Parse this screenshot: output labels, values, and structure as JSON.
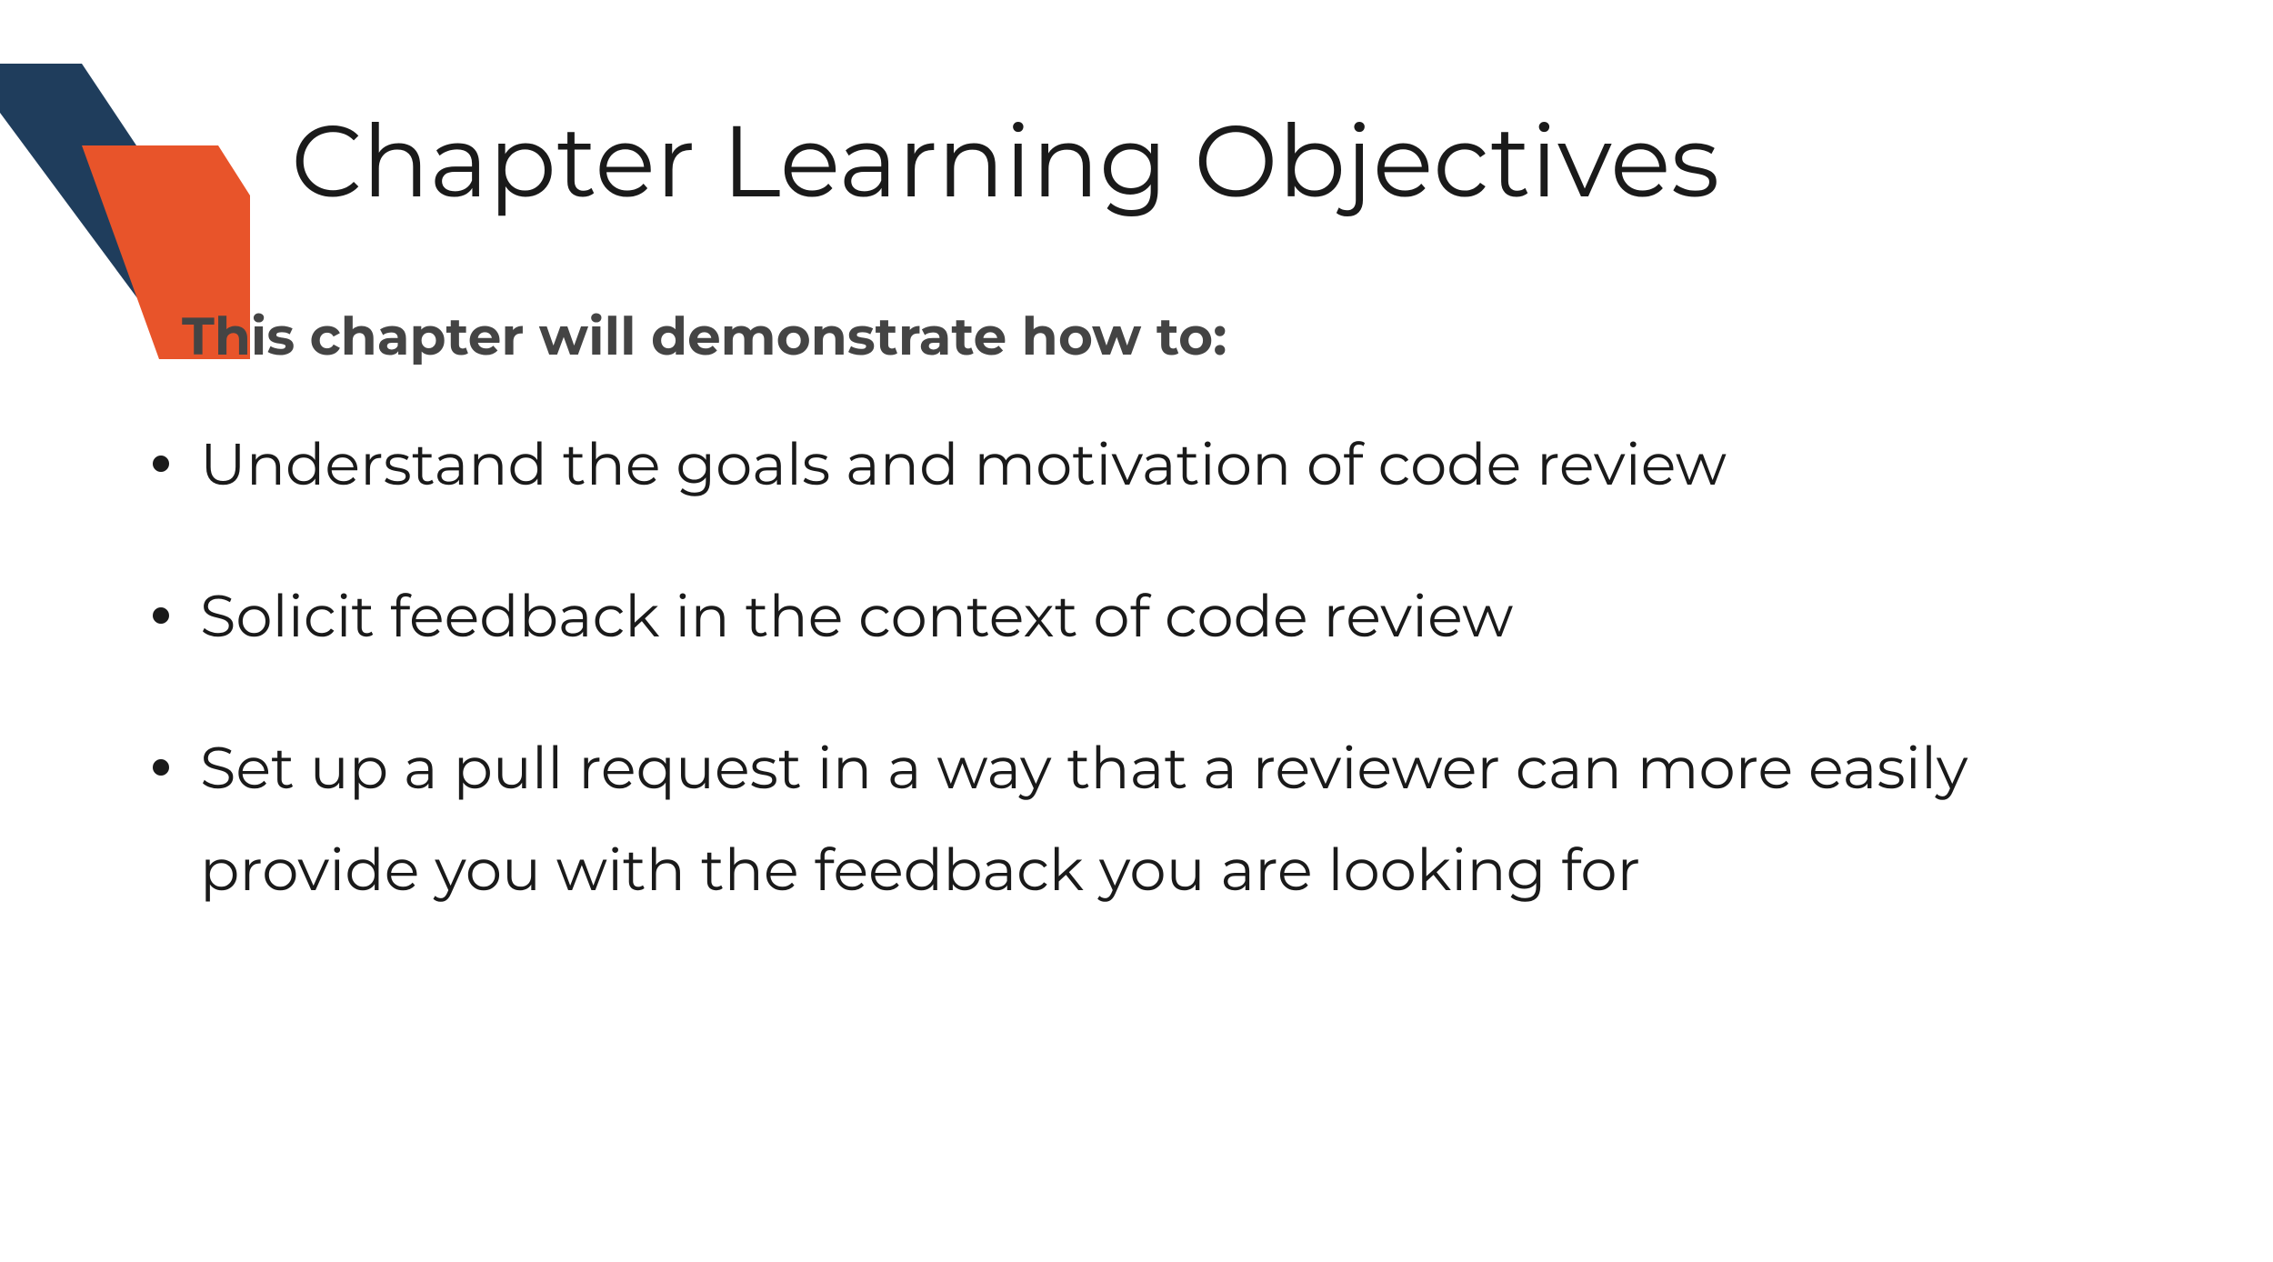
{
  "title": "Chapter Learning Objectives",
  "intro": "This chapter will demonstrate how to:",
  "bullets": [
    "Understand the goals and motivation of code review",
    "Solicit feedback in the context of code review",
    "Set up a pull request in a way that a reviewer can more easily provide you with the feedback you are looking for"
  ],
  "colors": {
    "navy": "#1f3d5c",
    "orange": "#e8542a"
  }
}
